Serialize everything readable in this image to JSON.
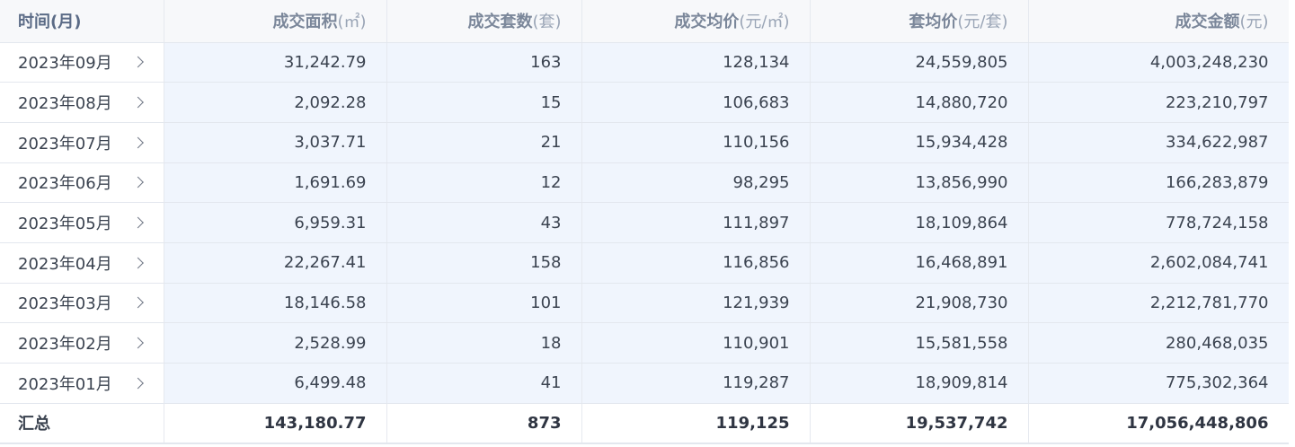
{
  "table": {
    "headers": [
      {
        "title": "时间",
        "unit": "(月)"
      },
      {
        "title": "成交面积",
        "unit": "(㎡)"
      },
      {
        "title": "成交套数",
        "unit": "(套)"
      },
      {
        "title": "成交均价",
        "unit": "(元/㎡)"
      },
      {
        "title": "套均价",
        "unit": "(元/套)"
      },
      {
        "title": "成交金额",
        "unit": "(元)"
      }
    ],
    "rows": [
      {
        "month": "2023年09月",
        "area": "31,242.79",
        "units": "163",
        "avg_price": "128,134",
        "unit_price": "24,559,805",
        "amount": "4,003,248,230"
      },
      {
        "month": "2023年08月",
        "area": "2,092.28",
        "units": "15",
        "avg_price": "106,683",
        "unit_price": "14,880,720",
        "amount": "223,210,797"
      },
      {
        "month": "2023年07月",
        "area": "3,037.71",
        "units": "21",
        "avg_price": "110,156",
        "unit_price": "15,934,428",
        "amount": "334,622,987"
      },
      {
        "month": "2023年06月",
        "area": "1,691.69",
        "units": "12",
        "avg_price": "98,295",
        "unit_price": "13,856,990",
        "amount": "166,283,879"
      },
      {
        "month": "2023年05月",
        "area": "6,959.31",
        "units": "43",
        "avg_price": "111,897",
        "unit_price": "18,109,864",
        "amount": "778,724,158"
      },
      {
        "month": "2023年04月",
        "area": "22,267.41",
        "units": "158",
        "avg_price": "116,856",
        "unit_price": "16,468,891",
        "amount": "2,602,084,741"
      },
      {
        "month": "2023年03月",
        "area": "18,146.58",
        "units": "101",
        "avg_price": "121,939",
        "unit_price": "21,908,730",
        "amount": "2,212,781,770"
      },
      {
        "month": "2023年02月",
        "area": "2,528.99",
        "units": "18",
        "avg_price": "110,901",
        "unit_price": "15,581,558",
        "amount": "280,468,035"
      },
      {
        "month": "2023年01月",
        "area": "6,499.48",
        "units": "41",
        "avg_price": "119,287",
        "unit_price": "18,909,814",
        "amount": "775,302,364"
      }
    ],
    "total": {
      "label": "汇总",
      "area": "143,180.77",
      "units": "873",
      "avg_price": "119,125",
      "unit_price": "19,537,742",
      "amount": "17,056,448,806"
    },
    "row_icon": "chevron-right-icon"
  }
}
